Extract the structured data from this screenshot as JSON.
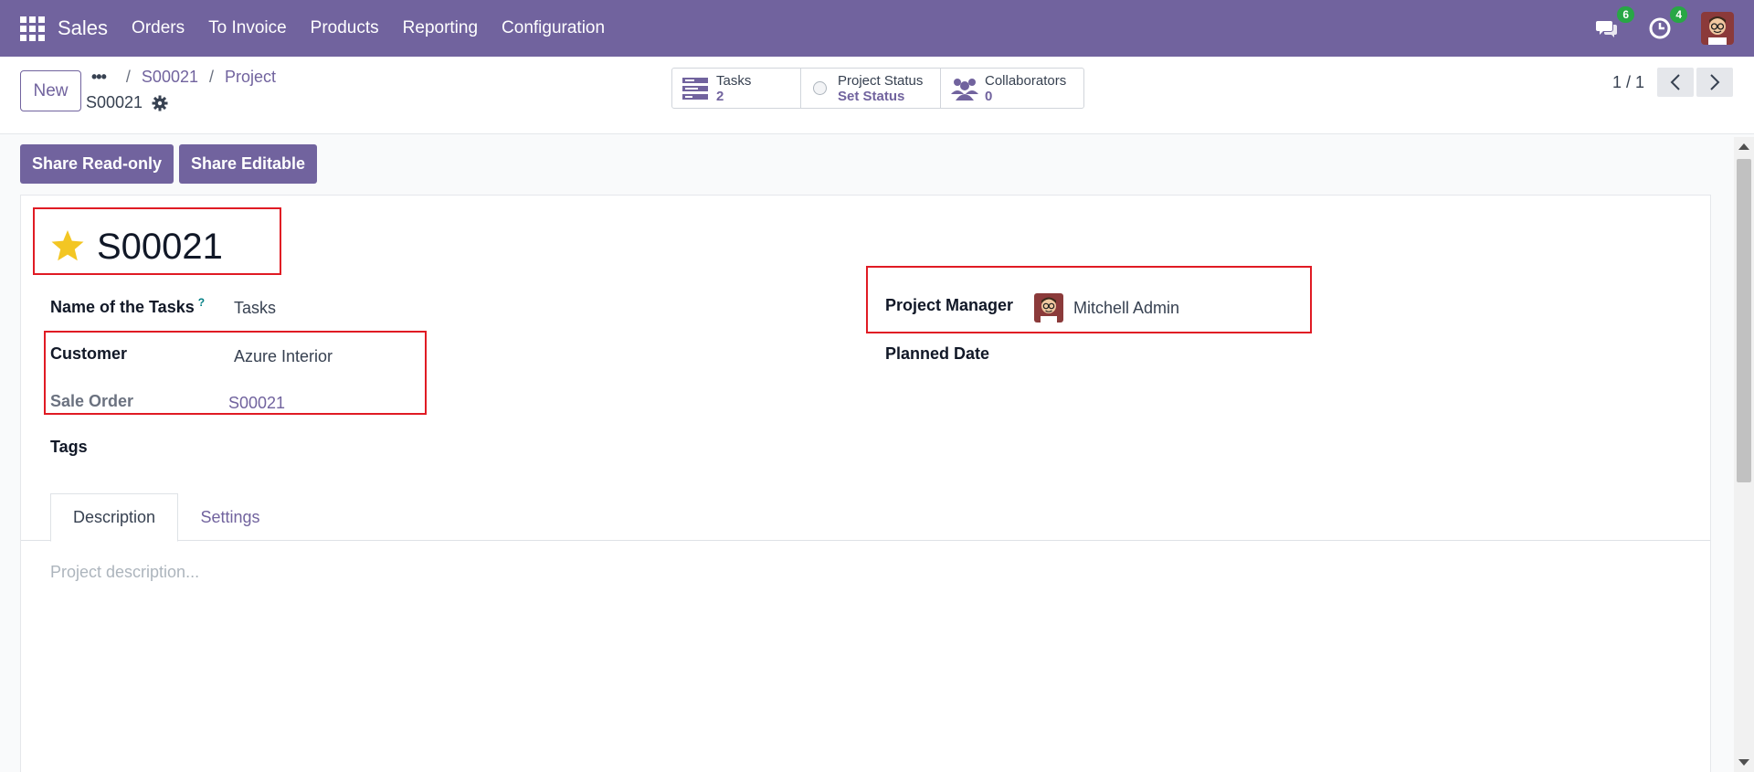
{
  "navbar": {
    "brand": "Sales",
    "menu": [
      "Orders",
      "To Invoice",
      "Products",
      "Reporting",
      "Configuration"
    ],
    "messages_count": "6",
    "activities_count": "4",
    "background_color": "#71639e"
  },
  "control_panel": {
    "new_label": "New",
    "breadcrumb": {
      "dots": "•••",
      "items": [
        "S00021",
        "Project"
      ]
    },
    "record_name": "S00021",
    "stats": {
      "tasks_label": "Tasks",
      "tasks_value": "2",
      "status_label": "Project Status",
      "status_value": "Set Status",
      "collaborators_label": "Collaborators",
      "collaborators_value": "0"
    },
    "pager": "1 / 1"
  },
  "share": {
    "readonly_label": "Share Read-only",
    "editable_label": "Share Editable"
  },
  "form": {
    "title": "S00021",
    "tasks_name_label": "Name of the Tasks",
    "tasks_name_help": "?",
    "tasks_name_value": "Tasks",
    "customer_label": "Customer",
    "customer_value": "Azure Interior",
    "sale_order_label": "Sale Order",
    "sale_order_value": "S00021",
    "tags_label": "Tags",
    "project_manager_label": "Project Manager",
    "project_manager_value": "Mitchell Admin",
    "planned_date_label": "Planned Date"
  },
  "tabs": {
    "description": "Description",
    "settings": "Settings"
  },
  "description_placeholder": "Project description...",
  "colors": {
    "accent": "#71639e",
    "highlight_box": "#e01b24",
    "star": "#f3c623"
  }
}
